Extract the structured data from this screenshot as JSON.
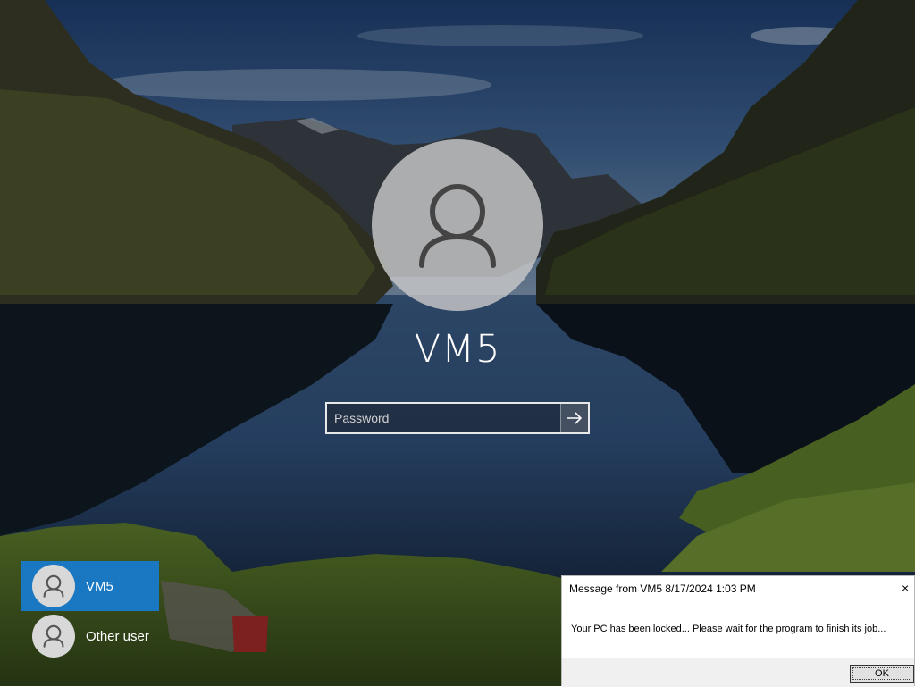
{
  "lock_screen": {
    "username": "VM5",
    "password_placeholder": "Password",
    "submit_icon": "arrow-right-icon",
    "avatar_icon": "user-icon"
  },
  "users": [
    {
      "name": "VM5",
      "selected": true
    },
    {
      "name": "Other user",
      "selected": false
    }
  ],
  "message_box": {
    "title": "Message from VM5 8/17/2024 1:03 PM",
    "close_label": "×",
    "text": "Your PC has been locked... Please wait for the program to finish its job...",
    "ok_label": "OK"
  },
  "colors": {
    "selected_user_bg": "#1a78c2",
    "avatar_bg": "#d8d8d8",
    "text_on_dark": "#ffffff"
  }
}
